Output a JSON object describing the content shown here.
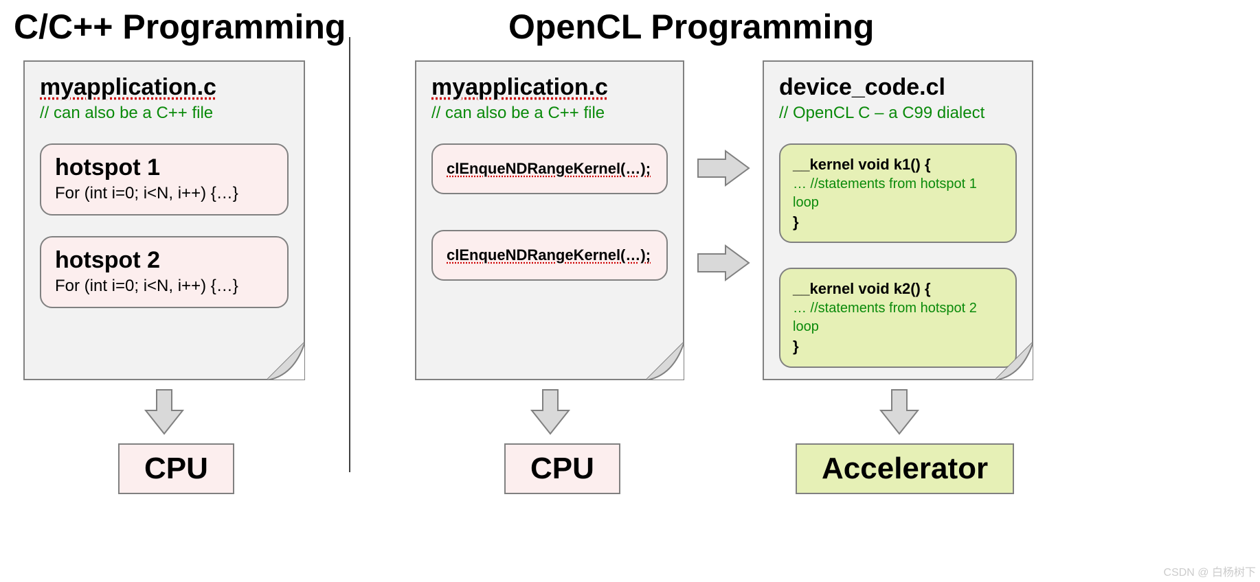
{
  "left": {
    "title": "C/C++ Programming",
    "file": {
      "name": "myapplication.c",
      "comment": "// can also be a C++ file",
      "hotspots": [
        {
          "title": "hotspot 1",
          "code": "For (int i=0; i<N, i++) {…}"
        },
        {
          "title": "hotspot 2",
          "code": "For (int i=0; i<N, i++) {…}"
        }
      ]
    },
    "target": "CPU"
  },
  "right": {
    "title": "OpenCL Programming",
    "host_file": {
      "name": "myapplication.c",
      "comment": "// can also be a C++ file",
      "calls": [
        "clEnqueNDRangeKernel(…);",
        "clEnqueNDRangeKernel(…);"
      ]
    },
    "device_file": {
      "name": "device_code.cl",
      "comment": "// OpenCL C – a C99 dialect",
      "kernels": [
        {
          "sig_open": "__kernel void k1() {",
          "body": "… //statements from hotspot 1 loop",
          "sig_close": "}"
        },
        {
          "sig_open": "__kernel void k2() {",
          "body": "… //statements from hotspot 2 loop",
          "sig_close": "}"
        }
      ]
    },
    "host_target": "CPU",
    "device_target": "Accelerator"
  },
  "watermark": "CSDN @ 白杨树下"
}
